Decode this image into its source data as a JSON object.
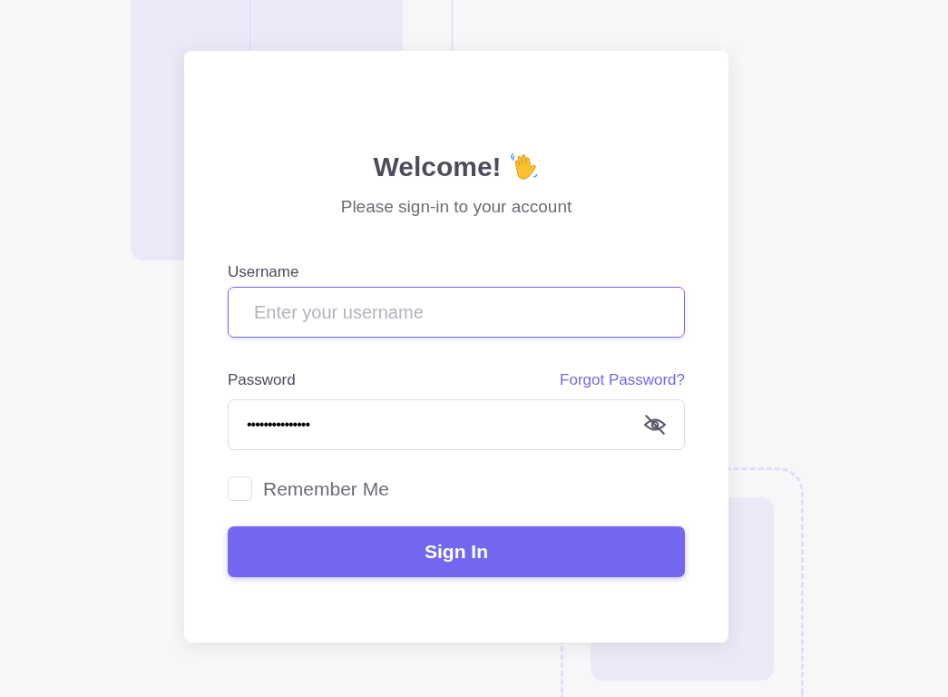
{
  "card": {
    "title": "Welcome!",
    "subtitle": "Please sign-in to your account"
  },
  "username": {
    "label": "Username",
    "placeholder": "Enter your username",
    "focused": true
  },
  "password": {
    "label": "Password",
    "forgot_link": "Forgot Password?",
    "value": "•••••••••••••••",
    "visible": false
  },
  "remember": {
    "label": "Remember Me",
    "checked": false
  },
  "submit": {
    "label": "Sign In"
  }
}
